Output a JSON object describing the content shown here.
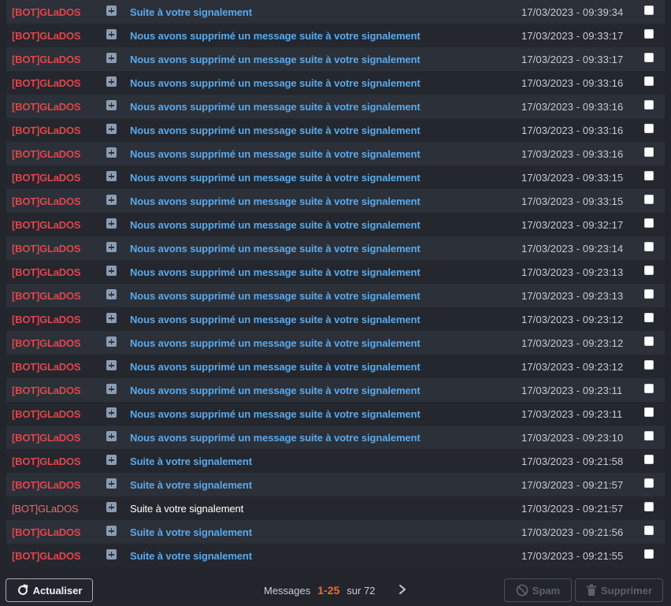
{
  "messages": [
    {
      "sender": "[BOT]GLaDOS",
      "subject": "Suite à votre signalement",
      "date": "17/03/2023 - 09:39:34",
      "read": false
    },
    {
      "sender": "[BOT]GLaDOS",
      "subject": "Nous avons supprimé un message suite à votre signalement",
      "date": "17/03/2023 - 09:33:17",
      "read": false
    },
    {
      "sender": "[BOT]GLaDOS",
      "subject": "Nous avons supprimé un message suite à votre signalement",
      "date": "17/03/2023 - 09:33:17",
      "read": false
    },
    {
      "sender": "[BOT]GLaDOS",
      "subject": "Nous avons supprimé un message suite à votre signalement",
      "date": "17/03/2023 - 09:33:16",
      "read": false
    },
    {
      "sender": "[BOT]GLaDOS",
      "subject": "Nous avons supprimé un message suite à votre signalement",
      "date": "17/03/2023 - 09:33:16",
      "read": false
    },
    {
      "sender": "[BOT]GLaDOS",
      "subject": "Nous avons supprimé un message suite à votre signalement",
      "date": "17/03/2023 - 09:33:16",
      "read": false
    },
    {
      "sender": "[BOT]GLaDOS",
      "subject": "Nous avons supprimé un message suite à votre signalement",
      "date": "17/03/2023 - 09:33:16",
      "read": false
    },
    {
      "sender": "[BOT]GLaDOS",
      "subject": "Nous avons supprimé un message suite à votre signalement",
      "date": "17/03/2023 - 09:33:15",
      "read": false
    },
    {
      "sender": "[BOT]GLaDOS",
      "subject": "Nous avons supprimé un message suite à votre signalement",
      "date": "17/03/2023 - 09:33:15",
      "read": false
    },
    {
      "sender": "[BOT]GLaDOS",
      "subject": "Nous avons supprimé un message suite à votre signalement",
      "date": "17/03/2023 - 09:32:17",
      "read": false
    },
    {
      "sender": "[BOT]GLaDOS",
      "subject": "Nous avons supprimé un message suite à votre signalement",
      "date": "17/03/2023 - 09:23:14",
      "read": false
    },
    {
      "sender": "[BOT]GLaDOS",
      "subject": "Nous avons supprimé un message suite à votre signalement",
      "date": "17/03/2023 - 09:23:13",
      "read": false
    },
    {
      "sender": "[BOT]GLaDOS",
      "subject": "Nous avons supprimé un message suite à votre signalement",
      "date": "17/03/2023 - 09:23:13",
      "read": false
    },
    {
      "sender": "[BOT]GLaDOS",
      "subject": "Nous avons supprimé un message suite à votre signalement",
      "date": "17/03/2023 - 09:23:12",
      "read": false
    },
    {
      "sender": "[BOT]GLaDOS",
      "subject": "Nous avons supprimé un message suite à votre signalement",
      "date": "17/03/2023 - 09:23:12",
      "read": false
    },
    {
      "sender": "[BOT]GLaDOS",
      "subject": "Nous avons supprimé un message suite à votre signalement",
      "date": "17/03/2023 - 09:23:12",
      "read": false
    },
    {
      "sender": "[BOT]GLaDOS",
      "subject": "Nous avons supprimé un message suite à votre signalement",
      "date": "17/03/2023 - 09:23:11",
      "read": false
    },
    {
      "sender": "[BOT]GLaDOS",
      "subject": "Nous avons supprimé un message suite à votre signalement",
      "date": "17/03/2023 - 09:23:11",
      "read": false
    },
    {
      "sender": "[BOT]GLaDOS",
      "subject": "Nous avons supprimé un message suite à votre signalement",
      "date": "17/03/2023 - 09:23:10",
      "read": false
    },
    {
      "sender": "[BOT]GLaDOS",
      "subject": "Suite à votre signalement",
      "date": "17/03/2023 - 09:21:58",
      "read": false
    },
    {
      "sender": "[BOT]GLaDOS",
      "subject": "Suite à votre signalement",
      "date": "17/03/2023 - 09:21:57",
      "read": false
    },
    {
      "sender": "[BOT]GLaDOS",
      "subject": "Suite à votre signalement",
      "date": "17/03/2023 - 09:21:57",
      "read": true
    },
    {
      "sender": "[BOT]GLaDOS",
      "subject": "Suite à votre signalement",
      "date": "17/03/2023 - 09:21:56",
      "read": false
    },
    {
      "sender": "[BOT]GLaDOS",
      "subject": "Suite à votre signalement",
      "date": "17/03/2023 - 09:21:55",
      "read": false
    }
  ],
  "footer": {
    "refresh_label": "Actualiser",
    "pager_prefix": "Messages",
    "pager_range": "1-25",
    "pager_total": "sur 72",
    "spam_label": "Spam",
    "delete_label": "Supprimer"
  },
  "icons": {
    "expand": "plus-square-icon",
    "refresh": "refresh-icon",
    "next": "chevron-right-icon",
    "spam": "ban-icon",
    "delete": "trash-icon"
  },
  "colors": {
    "background": "#22252b",
    "sender": "#e0454b",
    "subject_unread": "#5aa9ec",
    "subject_read": "#ffffff",
    "pager_range": "#f06a3c"
  }
}
